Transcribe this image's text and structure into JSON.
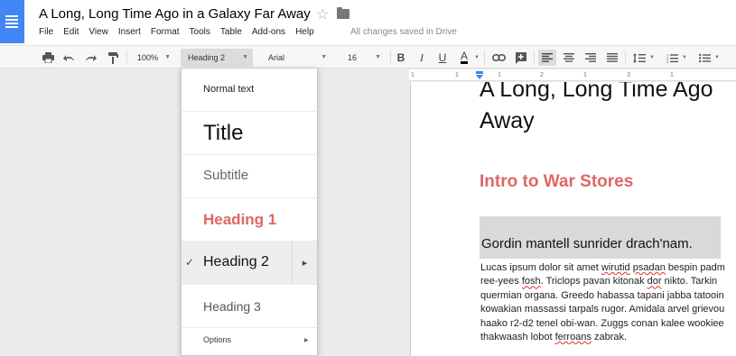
{
  "doc": {
    "title": "A Long, Long Time Ago in a Galaxy Far Away",
    "save_status": "All changes saved in Drive"
  },
  "menu": [
    "File",
    "Edit",
    "View",
    "Insert",
    "Format",
    "Tools",
    "Table",
    "Add-ons",
    "Help"
  ],
  "toolbar": {
    "zoom": "100%",
    "style": "Heading 2",
    "font": "Arial",
    "font_size": "16"
  },
  "ruler": {
    "ticks": [
      "1",
      "1",
      "1",
      "2",
      "1",
      "3",
      "1"
    ]
  },
  "content": {
    "heading_line1": "A Long, Long Time Ago",
    "heading_line2": "Away",
    "h1": "Intro to War Stores",
    "h2": "Gordin mantell sunrider drach'nam.",
    "body_lines": [
      "Lucas ipsum dolor sit amet wirutid psadan bespin padm",
      "ree-yees fosh. Triclops pavan kitonak dor nikto. Tarkin",
      "quermian organa. Greedo habassa tapani jabba tatooin",
      "kowakian massassi tarpals rugor. Amidala arvel grievou",
      "haako r2-d2 tenel obi-wan. Zuggs conan kalee wookiee",
      "thakwaash lobot ferroans zabrak."
    ]
  },
  "style_menu": {
    "items": [
      "Normal text",
      "Title",
      "Subtitle",
      "Heading 1",
      "Heading 2",
      "Heading 3"
    ],
    "selected": "Heading 2",
    "options_label": "Options"
  },
  "colors": {
    "brand": "#4285f4",
    "heading1": "#e06666",
    "h2_highlight": "#d9d9d9"
  }
}
